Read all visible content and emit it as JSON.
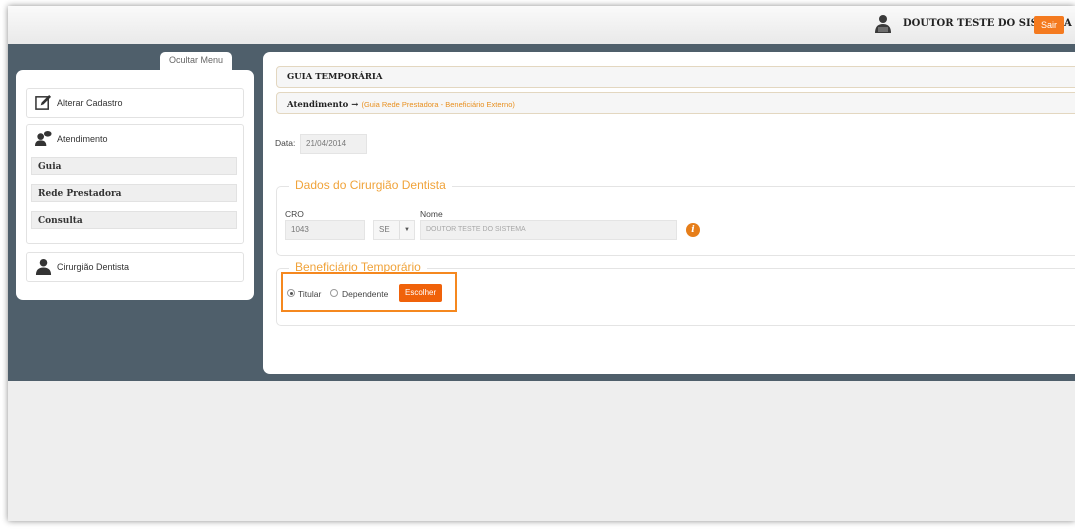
{
  "header": {
    "user_name": "DOUTOR TESTE DO SISTEMA",
    "logout_label": "Sair",
    "accent_color": "#f47a1f"
  },
  "sidebar": {
    "toggle_label": "Ocultar Menu",
    "alterar_cadastro": "Alterar Cadastro",
    "atendimento": "Atendimento",
    "sub_items": [
      "Guia",
      "Rede Prestadora",
      "Consulta"
    ],
    "cirurgiao": "Cirurgião Dentista"
  },
  "main": {
    "title": "GUIA TEMPORÁRIA",
    "breadcrumb_root": "Atendimento →",
    "breadcrumb_link": "(Guia Rede Prestadora - Beneficiário Externo)",
    "date_label": "Data:",
    "date_value": "21/04/2014",
    "dentist_section": {
      "legend": "Dados do Cirurgião Dentista",
      "cro_label": "CRO",
      "cro_value": "1043",
      "uf_value": "SE",
      "name_label": "Nome",
      "name_value": "DOUTOR TESTE DO SISTEMA"
    },
    "beneficiary_section": {
      "legend": "Beneficiário Temporário",
      "option_titular": "Titular",
      "option_dependente": "Dependente",
      "selected": "Titular",
      "choose_label": "Escolher"
    }
  }
}
